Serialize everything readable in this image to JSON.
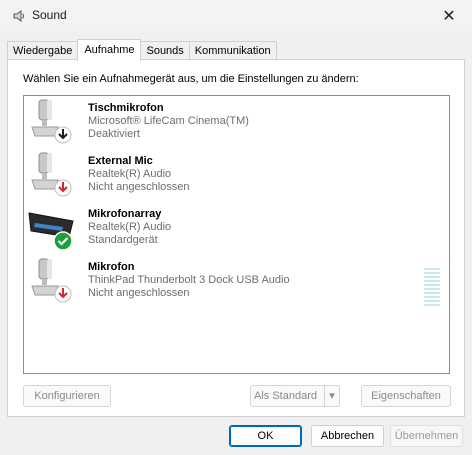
{
  "window": {
    "title": "Sound",
    "close_icon": "close-icon"
  },
  "tabs": [
    {
      "label": "Wiedergabe",
      "active": false
    },
    {
      "label": "Aufnahme",
      "active": true
    },
    {
      "label": "Sounds",
      "active": false
    },
    {
      "label": "Kommunikation",
      "active": false
    }
  ],
  "instruction": "Wählen Sie ein Aufnahmegerät aus, um die Einstellungen zu ändern:",
  "devices": [
    {
      "name": "Tischmikrofon",
      "driver": "Microsoft® LifeCam Cinema(TM)",
      "status": "Deaktiviert",
      "icon": "microphone-icon",
      "badge": "disabled-down-arrow-icon",
      "badge_color": "#1a1a1a"
    },
    {
      "name": "External Mic",
      "driver": "Realtek(R) Audio",
      "status": "Nicht angeschlossen",
      "icon": "microphone-icon",
      "badge": "unplugged-down-arrow-icon",
      "badge_color": "#d9232e"
    },
    {
      "name": "Mikrofonarray",
      "driver": "Realtek(R) Audio",
      "status": "Standardgerät",
      "icon": "microphone-array-icon",
      "badge": "default-checkmark-icon",
      "badge_color": "#1e9e3a"
    },
    {
      "name": "Mikrofon",
      "driver": "ThinkPad Thunderbolt 3 Dock USB Audio",
      "status": "Nicht angeschlossen",
      "icon": "microphone-icon",
      "badge": "unplugged-down-arrow-icon",
      "badge_color": "#d9232e"
    }
  ],
  "buttons": {
    "configure": "Konfigurieren",
    "set_default": "Als Standard",
    "properties": "Eigenschaften",
    "ok": "OK",
    "cancel": "Abbrechen",
    "apply": "Übernehmen"
  },
  "colors": {
    "accent": "#0067c0",
    "level_meter": "#c9e9ec"
  }
}
